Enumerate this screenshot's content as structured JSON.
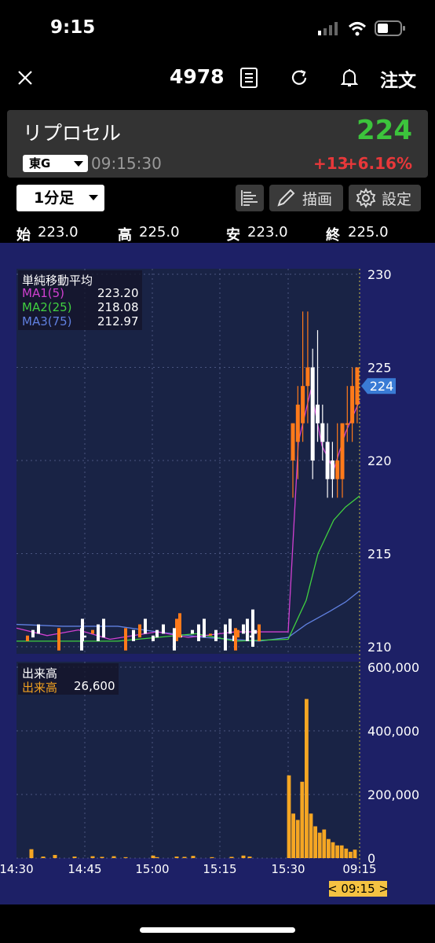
{
  "status_bar": {
    "time": "9:15"
  },
  "nav": {
    "code": "4978",
    "order": "注文"
  },
  "header": {
    "name": "リプロセル",
    "price": "224",
    "market": "東G",
    "update_time": "09:15:30",
    "change": "+13",
    "change_pct": "+6.16%"
  },
  "toolbar": {
    "interval": "1分足",
    "draw": "描画",
    "settings": "設定"
  },
  "ohlc": {
    "open_label": "始",
    "open": "223.0",
    "high_label": "高",
    "high": "225.0",
    "low_label": "安",
    "low": "223.0",
    "close_label": "終",
    "close": "225.0"
  },
  "ma_legend": {
    "title": "単純移動平均",
    "rows": [
      {
        "label": "MA1(5)",
        "value": "223.20",
        "color": "#d040d0"
      },
      {
        "label": "MA2(25)",
        "value": "218.08",
        "color": "#40d040"
      },
      {
        "label": "MA3(75)",
        "value": "212.97",
        "color": "#6080e0"
      }
    ]
  },
  "vol_legend": {
    "title": "出来高",
    "label": "出来高",
    "value": "26,600",
    "color": "#f0a020"
  },
  "colors": {
    "up": "#ff7a1a",
    "down": "#ffffff",
    "vol": "#f5a623",
    "bg": "#1d2066",
    "price_tag": "#3a7bd5",
    "cursor_tag": "#f5c242"
  },
  "chart_data": [
    {
      "type": "candlestick",
      "price_axis_ticks": [
        "230",
        "225",
        "220",
        "215",
        "210"
      ],
      "ylim": [
        210,
        230
      ],
      "x_ticks": [
        "14:30",
        "14:45",
        "15:00",
        "15:15",
        "15:30",
        "09:15"
      ],
      "current_price_tag": "224",
      "candles_after_1530": [
        {
          "o": 220,
          "h": 222,
          "l": 218,
          "c": 222
        },
        {
          "o": 221,
          "h": 224,
          "l": 219,
          "c": 223
        },
        {
          "o": 222,
          "h": 228,
          "l": 221,
          "c": 224
        },
        {
          "o": 224,
          "h": 228,
          "l": 222,
          "c": 225
        },
        {
          "o": 225,
          "h": 226,
          "l": 219,
          "c": 220
        },
        {
          "o": 223,
          "h": 227,
          "l": 221,
          "c": 222
        },
        {
          "o": 222,
          "h": 223,
          "l": 220,
          "c": 221
        },
        {
          "o": 221,
          "h": 222,
          "l": 218,
          "c": 219
        },
        {
          "o": 220,
          "h": 221,
          "l": 218,
          "c": 219
        },
        {
          "o": 219,
          "h": 222,
          "l": 218,
          "c": 220
        },
        {
          "o": 219,
          "h": 222,
          "l": 218,
          "c": 222
        },
        {
          "o": 222,
          "h": 224,
          "l": 221,
          "c": 222
        },
        {
          "o": 222,
          "h": 225,
          "l": 221,
          "c": 224
        },
        {
          "o": 223,
          "h": 225,
          "l": 222,
          "c": 225
        }
      ]
    },
    {
      "type": "bar",
      "title": "出来高",
      "ylim": [
        0,
        600000
      ],
      "y_ticks": [
        "600,000",
        "400,000",
        "200,000",
        "0"
      ],
      "values_after_1530": [
        260000,
        140000,
        120000,
        240000,
        500000,
        140000,
        100000,
        80000,
        90000,
        60000,
        50000,
        40000,
        40000,
        30000,
        20000,
        26600
      ]
    }
  ]
}
